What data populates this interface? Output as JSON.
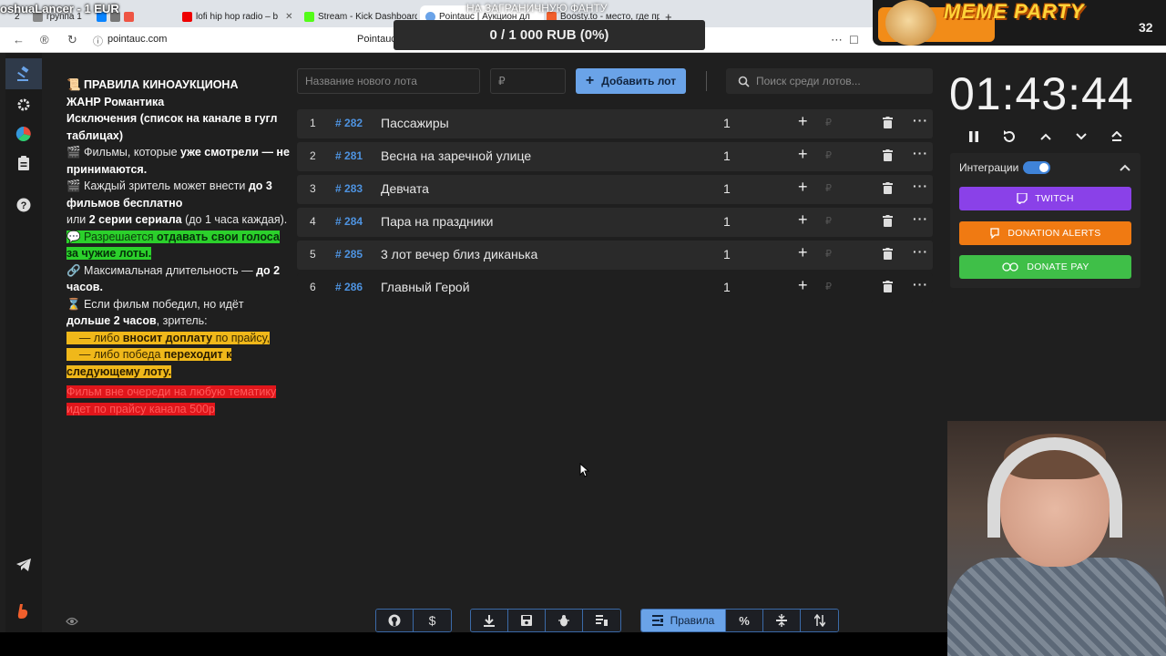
{
  "browser": {
    "tabs": [
      {
        "label": "2"
      },
      {
        "label": "группа 1"
      },
      {
        "label": "lofi hip hop radio – b"
      },
      {
        "label": "Stream - Kick Dashboard"
      },
      {
        "label": "Pointauc | Аукцион дл"
      },
      {
        "label": "Boosty.to - место, где пр"
      }
    ],
    "url": "pointauc.com",
    "content_title": "Pointauc"
  },
  "overlay": {
    "streamer_name": "oshuaLancer - 1 EUR",
    "top_text": "НА ЗАГРАНИЧНУЮ ФАНТУ",
    "goal_text": "0 / 1 000 RUB (0%)",
    "goal_min": "0",
    "goal_max": "1000",
    "meme_title": "MEME PARTY",
    "meme_number": "32"
  },
  "rules": {
    "title": "📜 ПРАВИЛА КИНОАУКЦИОНА",
    "genre": "ЖАНР Романтика",
    "exceptions": "Исключения (список на канале в гугл таблицах)",
    "r1_a": "🎬 Фильмы, которые ",
    "r1_b": "уже смотрели — не принимаются.",
    "r2_a": "🎬 Каждый зритель может внести ",
    "r2_b": "до 3 фильмов бесплатно",
    "r2_c": "или ",
    "r2_d": "2 серии сериала",
    "r2_e": " (до 1 часа каждая).",
    "r3_a": "💬 Разрешается ",
    "r3_b": "отдавать свои голоса за чужие лоты.",
    "r4_a": "🔗 Максимальная длительность — ",
    "r4_b": "до 2 часов.",
    "r5_a": "⌛ Если фильм победил, но идёт ",
    "r5_b": "дольше 2 часов",
    "r5_c": ", зритель:",
    "r6_a": "— либо ",
    "r6_b": "вносит доплату",
    "r6_c": " по прайсу,",
    "r7_a": "— либо победа ",
    "r7_b": "переходит к следующему лоту.",
    "r8": "Фильм вне очереди на любую тематику идет по прайсу канала 500р"
  },
  "controls": {
    "new_lot_placeholder": "Название нового лота",
    "amount_placeholder": "₽",
    "add_button": "Добавить лот",
    "search_placeholder": "Поиск среди лотов..."
  },
  "lots": [
    {
      "n": "1",
      "id": "282",
      "name": "Пассажиры",
      "amount": "1"
    },
    {
      "n": "2",
      "id": "281",
      "name": "Весна на заречной улице",
      "amount": "1"
    },
    {
      "n": "3",
      "id": "283",
      "name": "Девчата",
      "amount": "1"
    },
    {
      "n": "4",
      "id": "284",
      "name": "Пара на праздники",
      "amount": "1"
    },
    {
      "n": "5",
      "id": "285",
      "name": " 3 лот вечер близ диканька",
      "amount": "1"
    },
    {
      "n": "6",
      "id": "286",
      "name": "Главный Герой",
      "amount": "1"
    }
  ],
  "timer": {
    "value": "01:43:44"
  },
  "integrations": {
    "label": "Интеграции",
    "toggle_on": true,
    "twitch": "TWITCH",
    "donation_alerts": "DONATION ALERTS",
    "donate_pay": "DONATE PAY",
    "colors": {
      "twitch": "#8a41e8",
      "donation_alerts": "#f07a12",
      "donate_pay": "#3fbf48"
    }
  },
  "bottom": {
    "rules_label": "Правила"
  },
  "colors": {
    "accent": "#6aa3e8",
    "lot_id": "#4e93e0",
    "background": "#1f1f1f"
  }
}
